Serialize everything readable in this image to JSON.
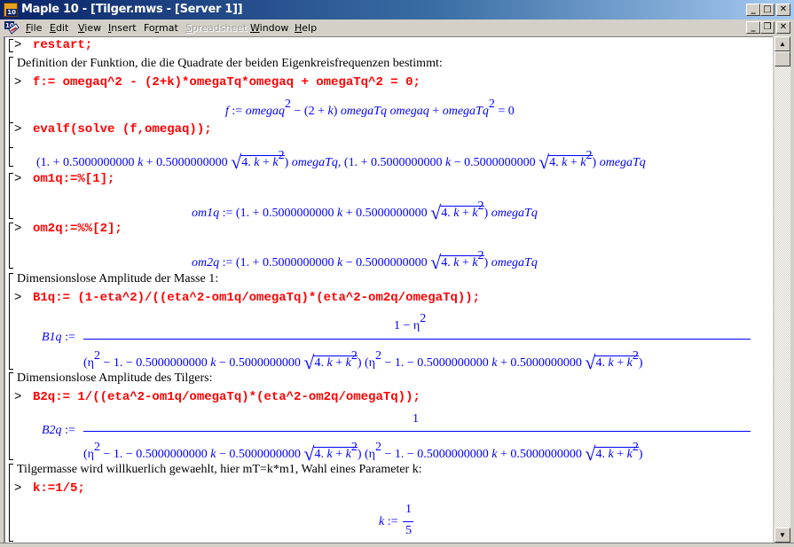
{
  "window": {
    "title": "Maple 10  - [Tilger.mws - [Server 1]]",
    "app_icon_badge": "10",
    "controls": [
      "minimize",
      "maximize",
      "close"
    ],
    "doc_controls": [
      "minimize",
      "restore",
      "close"
    ]
  },
  "menu": {
    "items": [
      {
        "label": "File",
        "accel": "F",
        "enabled": true
      },
      {
        "label": "Edit",
        "accel": "E",
        "enabled": true
      },
      {
        "label": "View",
        "accel": "V",
        "enabled": true
      },
      {
        "label": "Insert",
        "accel": "I",
        "enabled": true
      },
      {
        "label": "Format",
        "accel": "r",
        "enabled": true
      },
      {
        "label": "Spreadsheet",
        "accel": "S",
        "enabled": false
      },
      {
        "label": "Window",
        "accel": "W",
        "enabled": true
      },
      {
        "label": "Help",
        "accel": "H",
        "enabled": true
      }
    ]
  },
  "worksheet": {
    "prompt": ">",
    "groups": [
      {
        "input": "restart;"
      },
      {
        "text": "Definition der Funktion, die die Quadrate der beiden Eigenkreisfrequenzen bestimmt:",
        "input": "f:= omegaq^2 - (2+k)*omegaTq*omegaq + omegaTq^2 = 0;",
        "output": {
          "lhs": "f",
          "assign": ":=",
          "t1": "omegaq",
          "exp": "2",
          "t2": " − (2 + ",
          "k": "k",
          "t3": ") ",
          "t4": "omegaTq omegaq",
          "t5": " + ",
          "t6": "omegaTq",
          "t7": " = 0"
        }
      },
      {
        "input": "evalf(solve (f,omegaq));",
        "output": {
          "a": "(1. + 0.5000000000 ",
          "k": "k",
          "b1": " + 0.5000000000 ",
          "b2": " − 0.5000000000 ",
          "rad_a": "4. ",
          "rad_b": " + ",
          "exp": "2",
          "close": ") ",
          "var": "omegaTq",
          "sep": ", "
        }
      },
      {
        "input": "om1q:=%[1];",
        "output_lhs": "om1q"
      },
      {
        "input": "om2q:=%%[2];",
        "output_lhs": "om2q"
      },
      {
        "text": "Dimensionslose Amplitude der Masse 1:",
        "input": "B1q:= (1-eta^2)/((eta^2-om1q/omegaTq)*(eta^2-om2q/omegaTq));",
        "output": {
          "lhs": "B1q",
          "numerator": "1 − η",
          "num_exp": "2",
          "den_a": "(η",
          "den_b": " − 1. − 0.5000000000 ",
          "den_c1": " − 0.5000000000 ",
          "den_c2": " + 0.5000000000 "
        }
      },
      {
        "text": "Dimensionslose Amplitude des Tilgers:",
        "input": "B2q:= 1/((eta^2-om1q/omegaTq)*(eta^2-om2q/omegaTq));",
        "output": {
          "lhs": "B2q",
          "numerator": "1"
        }
      },
      {
        "text": "Tilgermasse wird willkuerlich gewaehlt, hier mT=k*m1, Wahl eines Parameter k:",
        "input": "k:=1/5;",
        "output": {
          "lhs": "k",
          "assign": ":=",
          "num": "1",
          "den": "5"
        }
      }
    ]
  }
}
